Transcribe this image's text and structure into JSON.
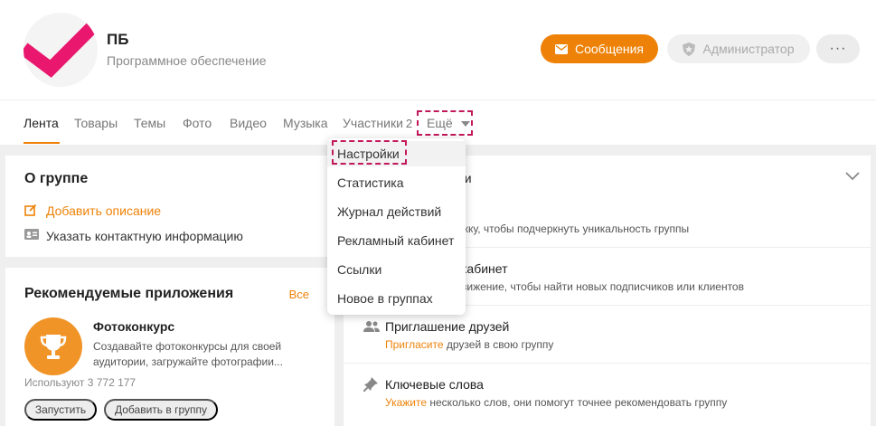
{
  "colors": {
    "accent": "#ee8208",
    "highlight_box": "#c2185b",
    "logo": "#e9186e"
  },
  "header": {
    "group_name": "ПБ",
    "group_category": "Программное обеспечение",
    "messages_label": "Сообщения",
    "admin_label": "Администратор",
    "more_label": "···"
  },
  "nav": {
    "items": [
      "Лента",
      "Товары",
      "Темы",
      "Фото",
      "Видео",
      "Музыка",
      "Участники"
    ],
    "members_count": "2",
    "more_label": "Ещё"
  },
  "about": {
    "title": "О группе",
    "add_description": "Добавить описание",
    "add_contact": "Указать контактную информацию"
  },
  "apps": {
    "title": "Рекомендуемые приложения",
    "all_label": "Все",
    "app_name": "Фотоконкурс",
    "app_desc": "Создавайте фотоконкурсы для своей аудитории, загружайте фотографии...",
    "users": "Используют 3 772 177",
    "run_label": "Запустить",
    "add_label": "Добавить в группу"
  },
  "right": {
    "item1_title": "ни",
    "item1_sub": "жку, чтобы подчеркнуть уникальность группы",
    "item2_title": "кабинет",
    "item2_sub": "вижение, чтобы найти новых подписчиков или клиентов",
    "item3_title": "Приглашение друзей",
    "item3_link": "Пригласите",
    "item3_sub": " друзей в свою группу",
    "item4_title": "Ключевые слова",
    "item4_link": "Укажите",
    "item4_sub": " несколько слов, они помогут точнее рекомендовать группу"
  },
  "dropdown": {
    "items": [
      "Настройки",
      "Статистика",
      "Журнал действий",
      "Рекламный кабинет",
      "Ссылки",
      "Новое в группах"
    ]
  }
}
